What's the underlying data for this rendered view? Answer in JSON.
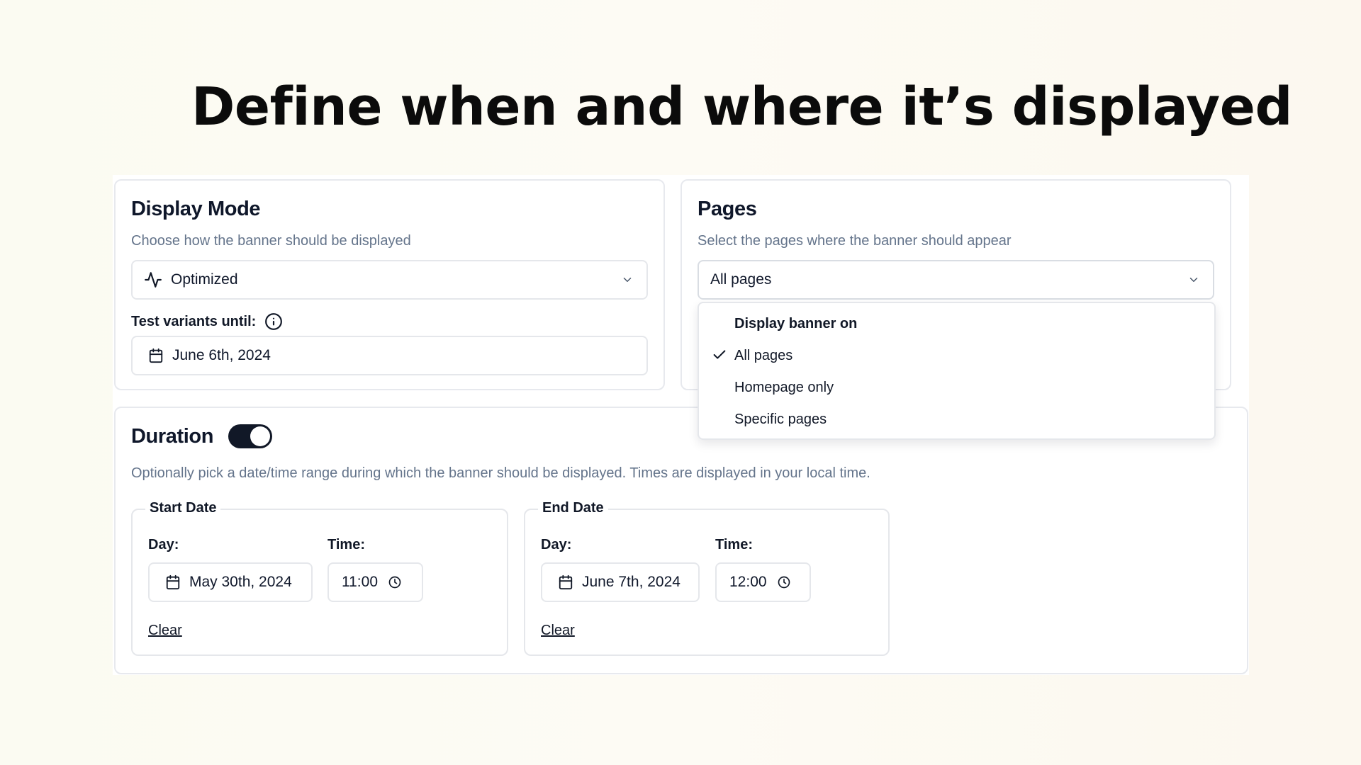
{
  "headline": "Define when and where it’s displayed",
  "display_mode": {
    "title": "Display Mode",
    "description": "Choose how the banner should be displayed",
    "select_value": "Optimized",
    "select_icon": "activity-pulse-icon",
    "test_label": "Test variants until:",
    "info_icon": "info-icon",
    "date_value": "June 6th, 2024"
  },
  "pages": {
    "title": "Pages",
    "description": "Select the pages where the banner should appear",
    "select_value": "All pages",
    "menu": {
      "heading": "Display banner on",
      "options": [
        "All pages",
        "Homepage only",
        "Specific pages"
      ],
      "selected": "All pages"
    }
  },
  "duration": {
    "title": "Duration",
    "enabled": true,
    "description": "Optionally pick a date/time range during which the banner should be displayed. Times are displayed in your local time.",
    "start": {
      "legend": "Start Date",
      "day_label": "Day:",
      "time_label": "Time:",
      "day_value": "May 30th, 2024",
      "time_value": "11:00",
      "clear_label": "Clear"
    },
    "end": {
      "legend": "End Date",
      "day_label": "Day:",
      "time_label": "Time:",
      "day_value": "June 7th, 2024",
      "time_value": "12:00",
      "clear_label": "Clear"
    }
  },
  "colors": {
    "toggle_on": "#111827",
    "muted_text": "#64748b",
    "border": "#e5e7eb"
  }
}
